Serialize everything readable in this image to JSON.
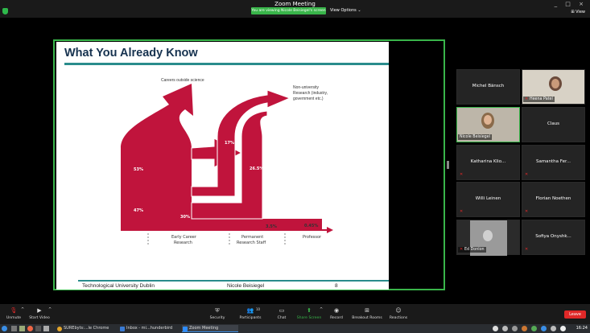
{
  "window": {
    "title": "Zoom Meeting",
    "controls": "_ □ ×"
  },
  "banner": {
    "text": "You are viewing Nicole Beisiegel's screen",
    "view_options": "View Options ⌄",
    "view": "⊞ View"
  },
  "slide": {
    "title": "What You Already Know",
    "footer_left": "Technological University Dublin",
    "footer_center": "Nicole Beisiegel",
    "footer_right": "8",
    "labels": {
      "careers": "Careers outside science",
      "nonuni_1": "Non-university",
      "nonuni_2": "Research (industry,",
      "nonuni_3": "government etc.)",
      "early_1": "Early Career",
      "early_2": "Research",
      "perm_1": "Permanent",
      "perm_2": "Research Staff",
      "professor": "Professor"
    },
    "values": {
      "p53": "53%",
      "p47": "47%",
      "p17": "17%",
      "p30": "30%",
      "p26": "26.5%",
      "p35": "3.5%",
      "p045": "0.45%"
    }
  },
  "participants": [
    {
      "name": "Michel Bänsch",
      "video": false,
      "muted": false
    },
    {
      "name": "Heena Patel",
      "video": true,
      "muted": true
    },
    {
      "name": "Nicole Beisiegel",
      "video": true,
      "muted": false,
      "active": true
    },
    {
      "name": "Claus",
      "video": false,
      "muted": false
    },
    {
      "name": "Katharina Klio...",
      "video": false,
      "muted": true
    },
    {
      "name": "Samantha Fer...",
      "video": false,
      "muted": true
    },
    {
      "name": "Willi Leinen",
      "video": false,
      "muted": true
    },
    {
      "name": "Florian Noethen",
      "video": false,
      "muted": true
    },
    {
      "name": "Ed Donlon",
      "video": true,
      "muted": true
    },
    {
      "name": "Sofiya Onyshk...",
      "video": false,
      "muted": true
    }
  ],
  "toolbar": {
    "unmute": "Unmute",
    "start_video": "Start Video",
    "security": "Security",
    "participants": "Participants",
    "participants_count": "10",
    "chat": "Chat",
    "share_screen": "Share Screen",
    "record": "Record",
    "breakout": "Breakout Rooms",
    "reactions": "Reactions",
    "leave": "Leave"
  },
  "taskbar": {
    "tasks": [
      "SUREbyts:...le Chrome",
      "Inbox - mi...hunderbird",
      "Zoom Meeting"
    ],
    "clock": "16:24"
  },
  "colors": {
    "accent_green": "#39b54a",
    "sankey_red": "#c0143c",
    "teal_rule": "#2a8c8c",
    "leave_red": "#e02828"
  }
}
